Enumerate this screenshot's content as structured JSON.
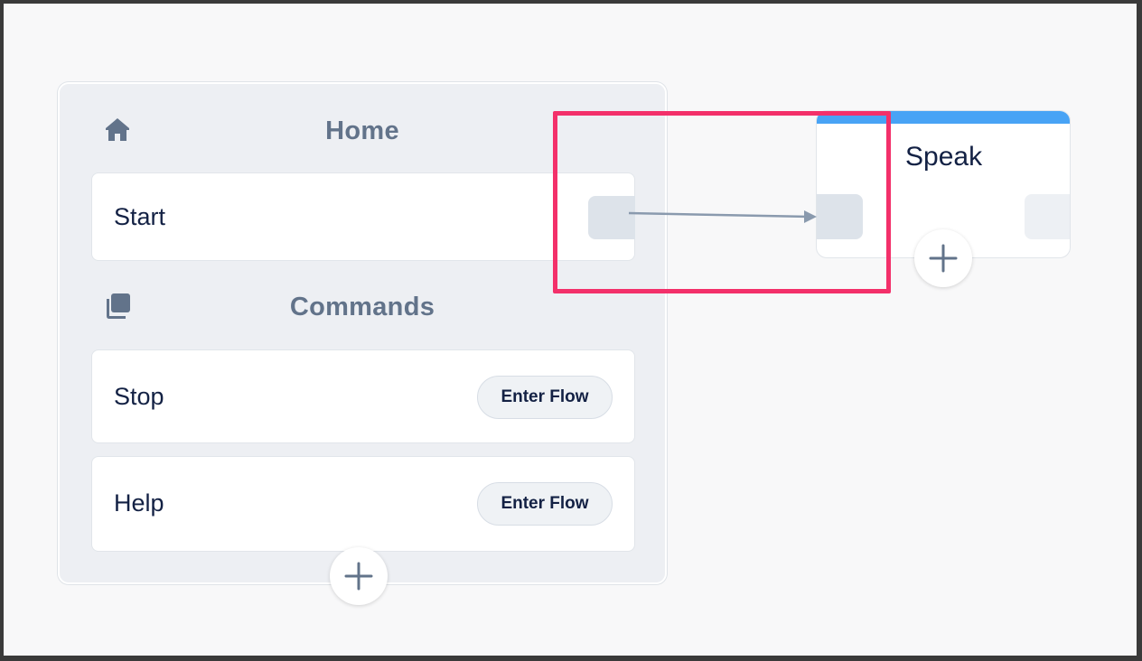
{
  "home": {
    "title": "Home",
    "start_label": "Start"
  },
  "commands": {
    "title": "Commands",
    "items": [
      {
        "label": "Stop",
        "button": "Enter Flow"
      },
      {
        "label": "Help",
        "button": "Enter Flow"
      }
    ]
  },
  "speak_node": {
    "title": "Speak"
  },
  "colors": {
    "accent": "#48a3f5",
    "highlight": "#f3306a",
    "section_title": "#62738a",
    "text": "#132144"
  }
}
